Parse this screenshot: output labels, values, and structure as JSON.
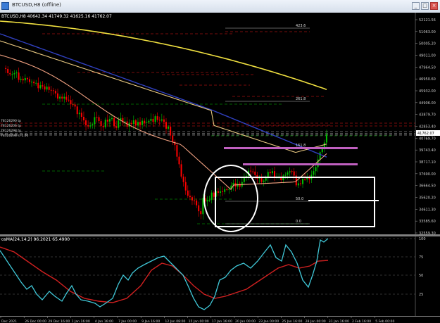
{
  "window": {
    "title": "BTCUSD,H8 (offline)",
    "buttons": [
      "_",
      "□",
      "×"
    ]
  },
  "chart": {
    "info": "BTCUSD,H8  40642.34 41749.32 41625.16 41762.07",
    "price_labels": [
      "52121.56",
      "51063.00",
      "50005.20",
      "49011.00",
      "47964.50",
      "46950.60",
      "45932.00",
      "44906.00",
      "43879.70",
      "42853.40",
      "40769.70",
      "39743.40",
      "38717.10",
      "37690.00",
      "36664.50",
      "35620.20",
      "34611.30",
      "33585.60",
      "32559.30"
    ],
    "current_price": "41762.07",
    "left_labels": [
      "78126290 tp",
      "78126206 tp",
      "78126298 tp",
      "78126298 sl 1.00"
    ],
    "fib_labels": [
      "423.6",
      "261.8",
      "161.8",
      "50.0",
      "0.0"
    ]
  },
  "oscillator": {
    "label": "osMA(24,14,2) 96.2021 65.4900",
    "levels": [
      "100",
      "75",
      "50",
      "25"
    ]
  },
  "date_axis": [
    "Dec 2021",
    "26 Dec 00:00",
    "29 Dec 16:00",
    "1 Jan 16:00",
    "4 Jan 16:00",
    "7 Jan 00:00",
    "9 Jan 16:00",
    "12 Jan 08:00",
    "15 Jan 00:00",
    "17 Jan 16:00",
    "20 Jan 00:00",
    "23 Jan 00:00",
    "25 Jan 16:00",
    "28 Jan 00:00",
    "31 Jan 16:00",
    "2 Feb 16:00",
    "5 Feb 00:00"
  ],
  "colors": {
    "up": "#00c000",
    "down": "#ff0000",
    "ema_yellow": "#f0e040",
    "ema_blue": "#3040c0",
    "ema_tan": "#e8c880",
    "ema_salmon": "#f0a080",
    "magenta": "#c060c0",
    "cyan": "#40c8d8",
    "red": "#d02020"
  }
}
